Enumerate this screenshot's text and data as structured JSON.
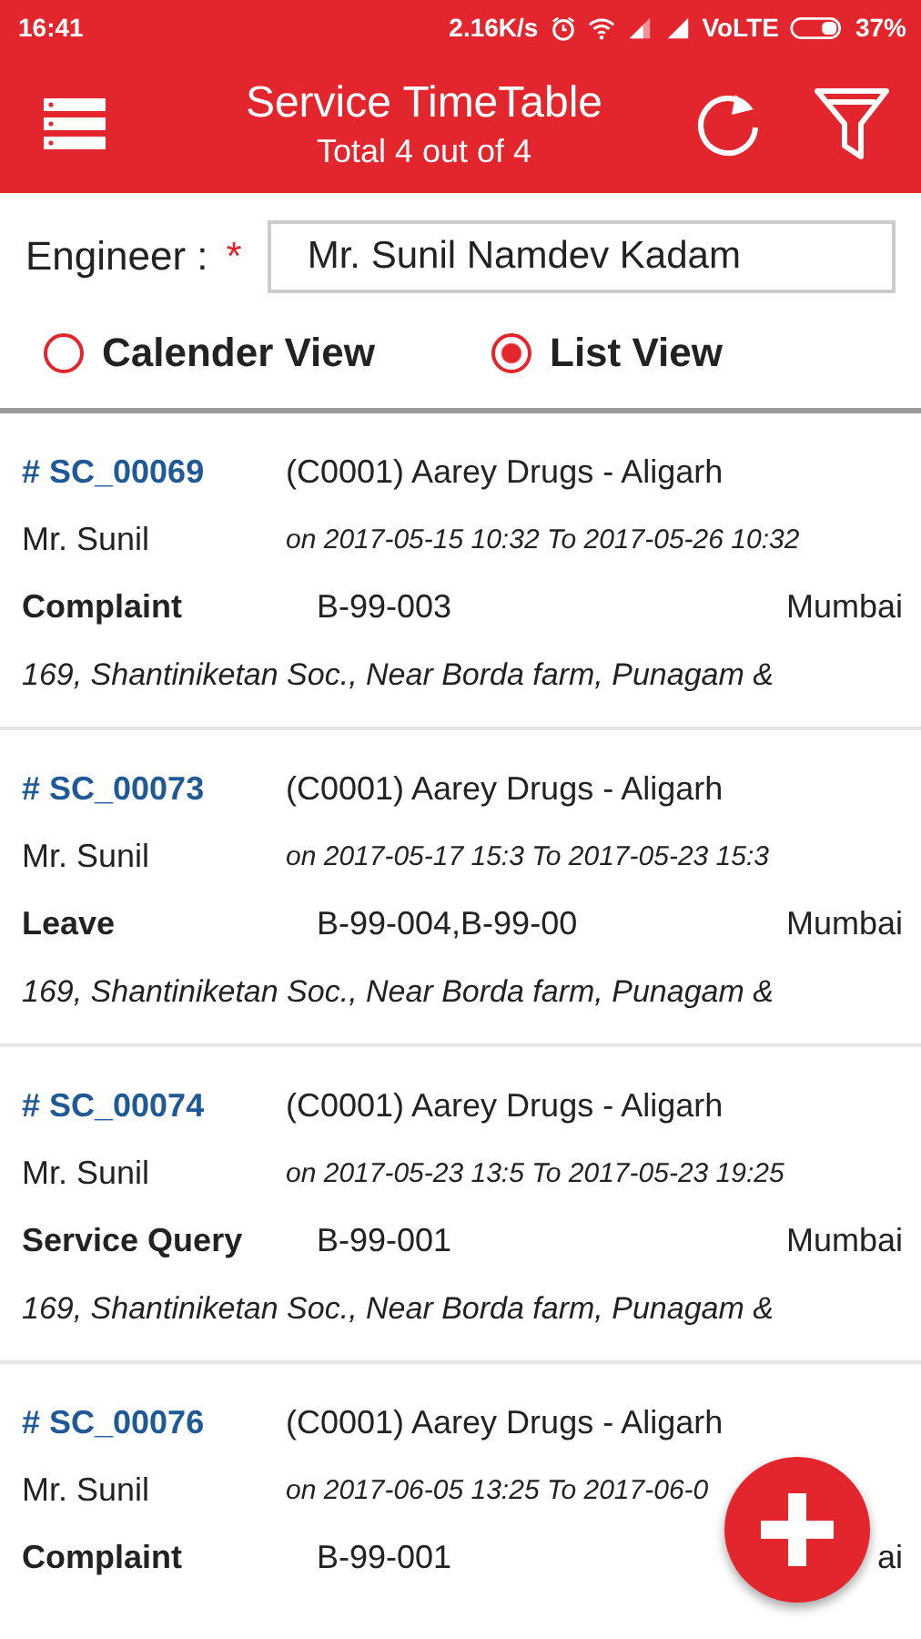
{
  "status_bar": {
    "time": "16:41",
    "speed": "2.16K/s",
    "network": "VoLTE",
    "battery": "37%"
  },
  "toolbar": {
    "title": "Service TimeTable",
    "subtitle": "Total 4 out of 4"
  },
  "engineer": {
    "label": "Engineer :",
    "required_mark": "*",
    "value": "Mr. Sunil Namdev Kadam"
  },
  "view_options": [
    {
      "label": "Calender View",
      "selected": false
    },
    {
      "label": "List View",
      "selected": true
    }
  ],
  "services": [
    {
      "id": "# SC_00069",
      "customer": "(C0001) Aarey Drugs - Aligarh",
      "engineer": "Mr. Sunil",
      "schedule": "on 2017-05-15 10:32 To 2017-05-26 10:32",
      "type": "Complaint",
      "code": "B-99-003",
      "city": "Mumbai",
      "address": "169, Shantiniketan Soc., Near Borda farm, Punagam &"
    },
    {
      "id": "# SC_00073",
      "customer": "(C0001) Aarey Drugs - Aligarh",
      "engineer": "Mr. Sunil",
      "schedule": "on 2017-05-17 15:3 To 2017-05-23 15:3",
      "type": "Leave",
      "code": "B-99-004,B-99-00",
      "city": "Mumbai",
      "address": "169, Shantiniketan Soc., Near Borda farm, Punagam &"
    },
    {
      "id": "# SC_00074",
      "customer": "(C0001) Aarey Drugs - Aligarh",
      "engineer": "Mr. Sunil",
      "schedule": "on 2017-05-23 13:5 To 2017-05-23 19:25",
      "type": "Service Query",
      "code": "B-99-001",
      "city": "Mumbai",
      "address": "169, Shantiniketan Soc., Near Borda farm, Punagam &"
    },
    {
      "id": "# SC_00076",
      "customer": "(C0001) Aarey Drugs - Aligarh",
      "engineer": "Mr. Sunil",
      "schedule": "on 2017-06-05 13:25 To 2017-06-0",
      "type": "Complaint",
      "code": "B-99-001",
      "city": "ai"
    }
  ]
}
